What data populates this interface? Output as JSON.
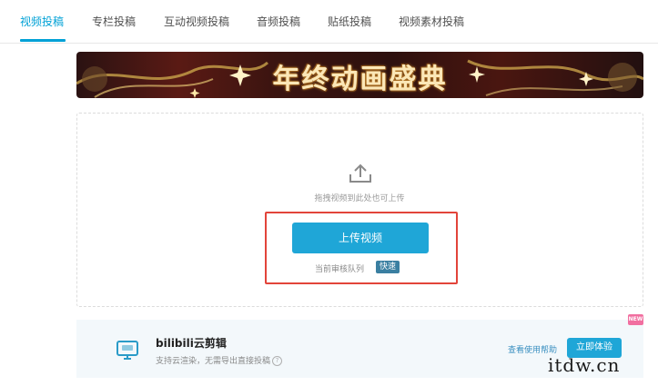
{
  "tabs": [
    {
      "label": "视频投稿",
      "active": true
    },
    {
      "label": "专栏投稿",
      "active": false
    },
    {
      "label": "互动视频投稿",
      "active": false
    },
    {
      "label": "音频投稿",
      "active": false
    },
    {
      "label": "贴纸投稿",
      "active": false
    },
    {
      "label": "视频素材投稿",
      "active": false
    }
  ],
  "banner": {
    "title": "年终动画盛典"
  },
  "upload": {
    "hint": "拖拽视频到此处也可上传",
    "button_label": "上传视频",
    "queue_label": "当前审核队列",
    "queue_status": "快速"
  },
  "promo": {
    "title": "bilibili云剪辑",
    "subtitle": "支持云渲染，无需导出直接投稿",
    "help_link": "查看使用帮助",
    "try_button": "立即体验",
    "new_badge": "NEW"
  },
  "watermark": "itdw.cn",
  "colors": {
    "accent": "#00a1d6",
    "button": "#1fa6d7",
    "highlight_border": "#e2443a",
    "queue_badge": "#3a7fa1",
    "new_badge": "#f16fa0"
  },
  "icons": {
    "upload": "upload-icon",
    "promo": "monitor-icon",
    "help": "question-icon"
  }
}
